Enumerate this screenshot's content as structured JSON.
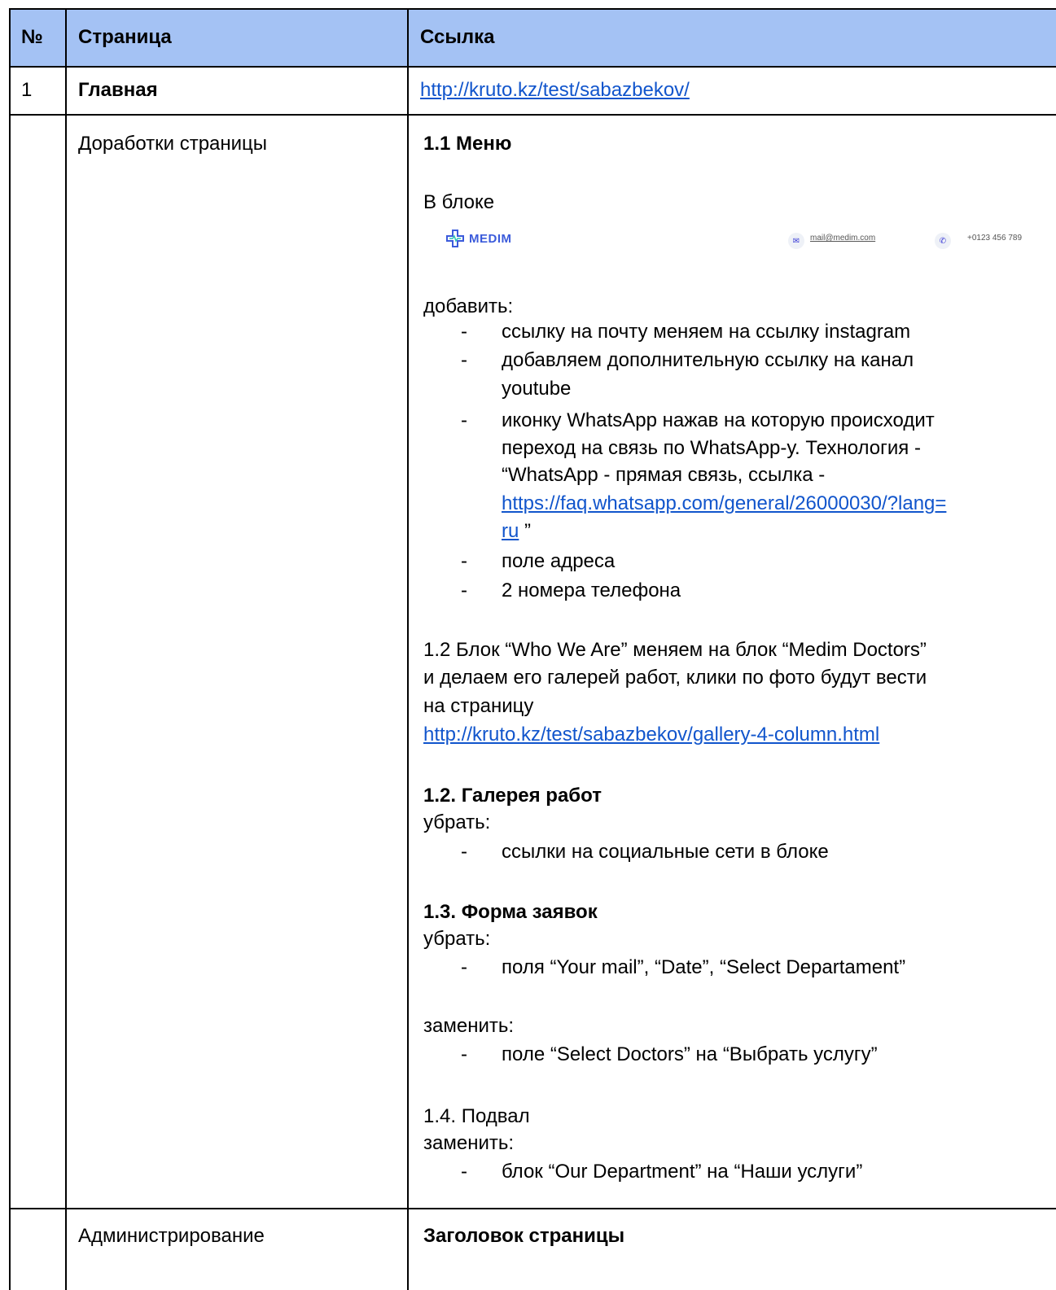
{
  "header": {
    "num": "№",
    "page": "Страница",
    "link": "Ссылка"
  },
  "row1": {
    "num": "1",
    "page": "Главная",
    "link": "http://kruto.kz/test/sabazbekov/"
  },
  "row2": {
    "page": "Доработки страницы",
    "s11_title": "1.1 Меню",
    "s11_intro": "В блоке",
    "snippet": {
      "logo": "MEDIM",
      "mail": "mail@medim.com",
      "phone": "+0123 456 789"
    },
    "add_label": "добавить:",
    "bullets": [
      "ссылку на почту меняем на ссылку instagram",
      "добавляем дополнительную ссылку на канал",
      "youtube",
      "иконку WhatsApp нажав на которую происходит",
      "переход на связь по WhatsApp-у. Технология -",
      "“WhatsApp - прямая связь, ссылка -",
      "https://faq.whatsapp.com/general/26000030/?lang=",
      "ru",
      " ”",
      "поле адреса",
      "2 номера телефона"
    ],
    "s12_lines": [
      "1.2 Блок “Who We Are” меняем на блок “Medim Doctors”",
      "и делаем его галерей работ, клики по фото будут вести",
      "на страницу"
    ],
    "s12_link": "http://kruto.kz/test/sabazbekov/gallery-4-column.html",
    "gallery_title": "1.2. Галерея работ",
    "gallery_remove": "убрать:",
    "gallery_item": "ссылки на социальные сети в блоке",
    "form_title": "1.3. Форма заявок",
    "form_remove": "убрать:",
    "form_item": "поля “Your mail”, “Date”, “Select Departament”",
    "form_replace": "заменить:",
    "form_replace_item": "поле “Select Doctors” на “Выбрать услугу”",
    "footer_title": "1.4. Подвал",
    "footer_replace": "заменить:",
    "footer_item": "блок “Our Department” на “Наши услуги”",
    "dash": "-"
  },
  "row3": {
    "page": "Администрирование",
    "link_title": "Заголовок страницы"
  }
}
